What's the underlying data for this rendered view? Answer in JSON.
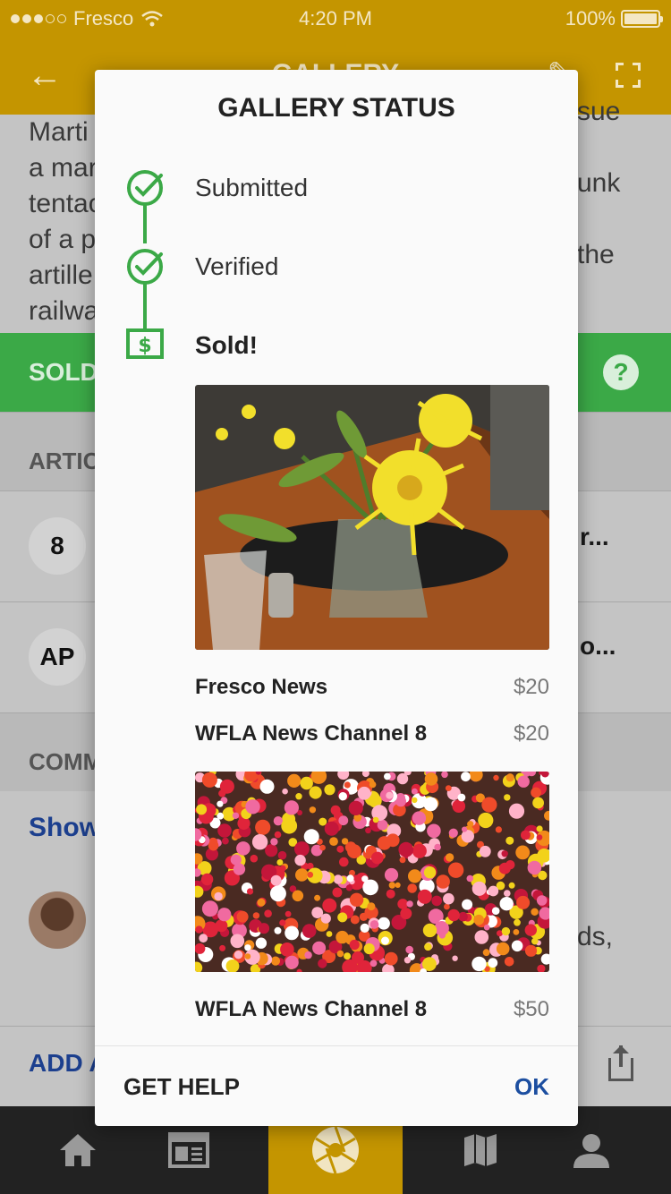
{
  "status_bar": {
    "carrier": "Fresco",
    "time": "4:20 PM",
    "battery": "100%"
  },
  "header": {
    "title": "GALLERY"
  },
  "background": {
    "story_lines_left": [
      "Marti",
      "a mar",
      "tentac",
      "of a p",
      "artille",
      "railwa"
    ],
    "story_lines_right": [
      "sue",
      "",
      "unk",
      "",
      "the",
      ""
    ],
    "sold_label": "SOLD",
    "articles_label": "ARTIC",
    "article_1": {
      "logo": "8",
      "snippet": "r..."
    },
    "article_2": {
      "logo": "AP",
      "snippet": "o..."
    },
    "comments_label": "COMM",
    "show_label": "Show",
    "comment_snippet": "ds,",
    "add_label": "ADD A"
  },
  "modal": {
    "title": "GALLERY STATUS",
    "steps": [
      {
        "label": "Submitted"
      },
      {
        "label": "Verified"
      },
      {
        "label": "Sold!"
      }
    ],
    "photo_1": {
      "purchases": [
        {
          "outlet": "Fresco News",
          "price": "$20"
        },
        {
          "outlet": "WFLA News Channel 8",
          "price": "$20"
        }
      ]
    },
    "photo_2": {
      "purchases": [
        {
          "outlet": "WFLA News Channel 8",
          "price": "$50"
        }
      ]
    },
    "help_button": "GET HELP",
    "ok_button": "OK"
  },
  "colors": {
    "brand_gold": "#c49500",
    "success_green": "#3ba947",
    "link_blue": "#1c4ea0"
  },
  "tabs": [
    {
      "icon": "home-icon"
    },
    {
      "icon": "news-icon"
    },
    {
      "icon": "camera-shutter-icon",
      "active": true
    },
    {
      "icon": "map-icon"
    },
    {
      "icon": "profile-icon"
    }
  ]
}
